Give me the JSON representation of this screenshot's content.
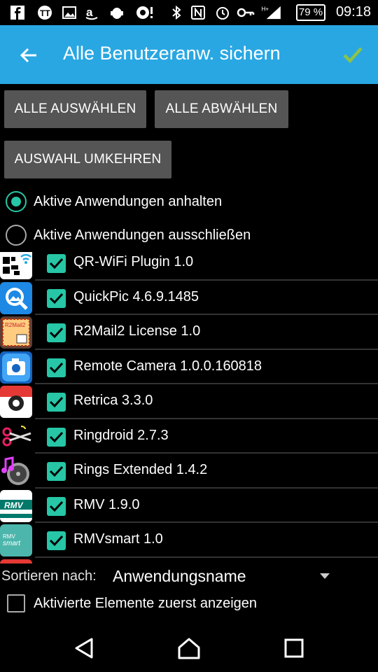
{
  "status_bar": {
    "battery": "79 %",
    "time": "09:18"
  },
  "app_bar": {
    "title": "Alle Benutzeranw. sichern",
    "back_icon": "arrow-back-icon",
    "confirm_icon": "check-icon",
    "accent": "#29a7e2",
    "confirm_color": "#8bc34a"
  },
  "buttons": {
    "select_all": "ALLE AUSWÄHLEN",
    "deselect_all": "ALLE ABWÄHLEN",
    "invert": "AUSWAHL UMKEHREN"
  },
  "options": {
    "pause_active": "Aktive Anwendungen anhalten",
    "exclude_active": "Aktive Anwendungen ausschließen",
    "selected": "pause_active"
  },
  "apps": [
    {
      "label": "QR-WiFi Plugin 1.0",
      "checked": true,
      "icon": "qr-wifi-icon"
    },
    {
      "label": "QuickPic 4.6.9.1485",
      "checked": true,
      "icon": "quickpic-icon"
    },
    {
      "label": "R2Mail2 License 1.0",
      "checked": true,
      "icon": "r2mail2-icon"
    },
    {
      "label": "Remote Camera 1.0.0.160818",
      "checked": true,
      "icon": "remote-camera-icon"
    },
    {
      "label": "Retrica 3.3.0",
      "checked": true,
      "icon": "retrica-icon"
    },
    {
      "label": "Ringdroid 2.7.3",
      "checked": true,
      "icon": "ringdroid-icon"
    },
    {
      "label": "Rings Extended 1.4.2",
      "checked": true,
      "icon": "rings-extended-icon"
    },
    {
      "label": "RMV 1.9.0",
      "checked": true,
      "icon": "rmv-icon"
    },
    {
      "label": "RMVsmart 1.0",
      "checked": true,
      "icon": "rmvsmart-icon"
    }
  ],
  "sort": {
    "label": "Sortieren nach:",
    "value": "Anwendungsname"
  },
  "show_active_first": {
    "label": "Aktivierte Elemente zuerst anzeigen",
    "checked": false
  },
  "nav": {
    "back": "nav-back-icon",
    "home": "nav-home-icon",
    "recents": "nav-recents-icon"
  },
  "colors": {
    "checkbox": "#26c6a6"
  }
}
